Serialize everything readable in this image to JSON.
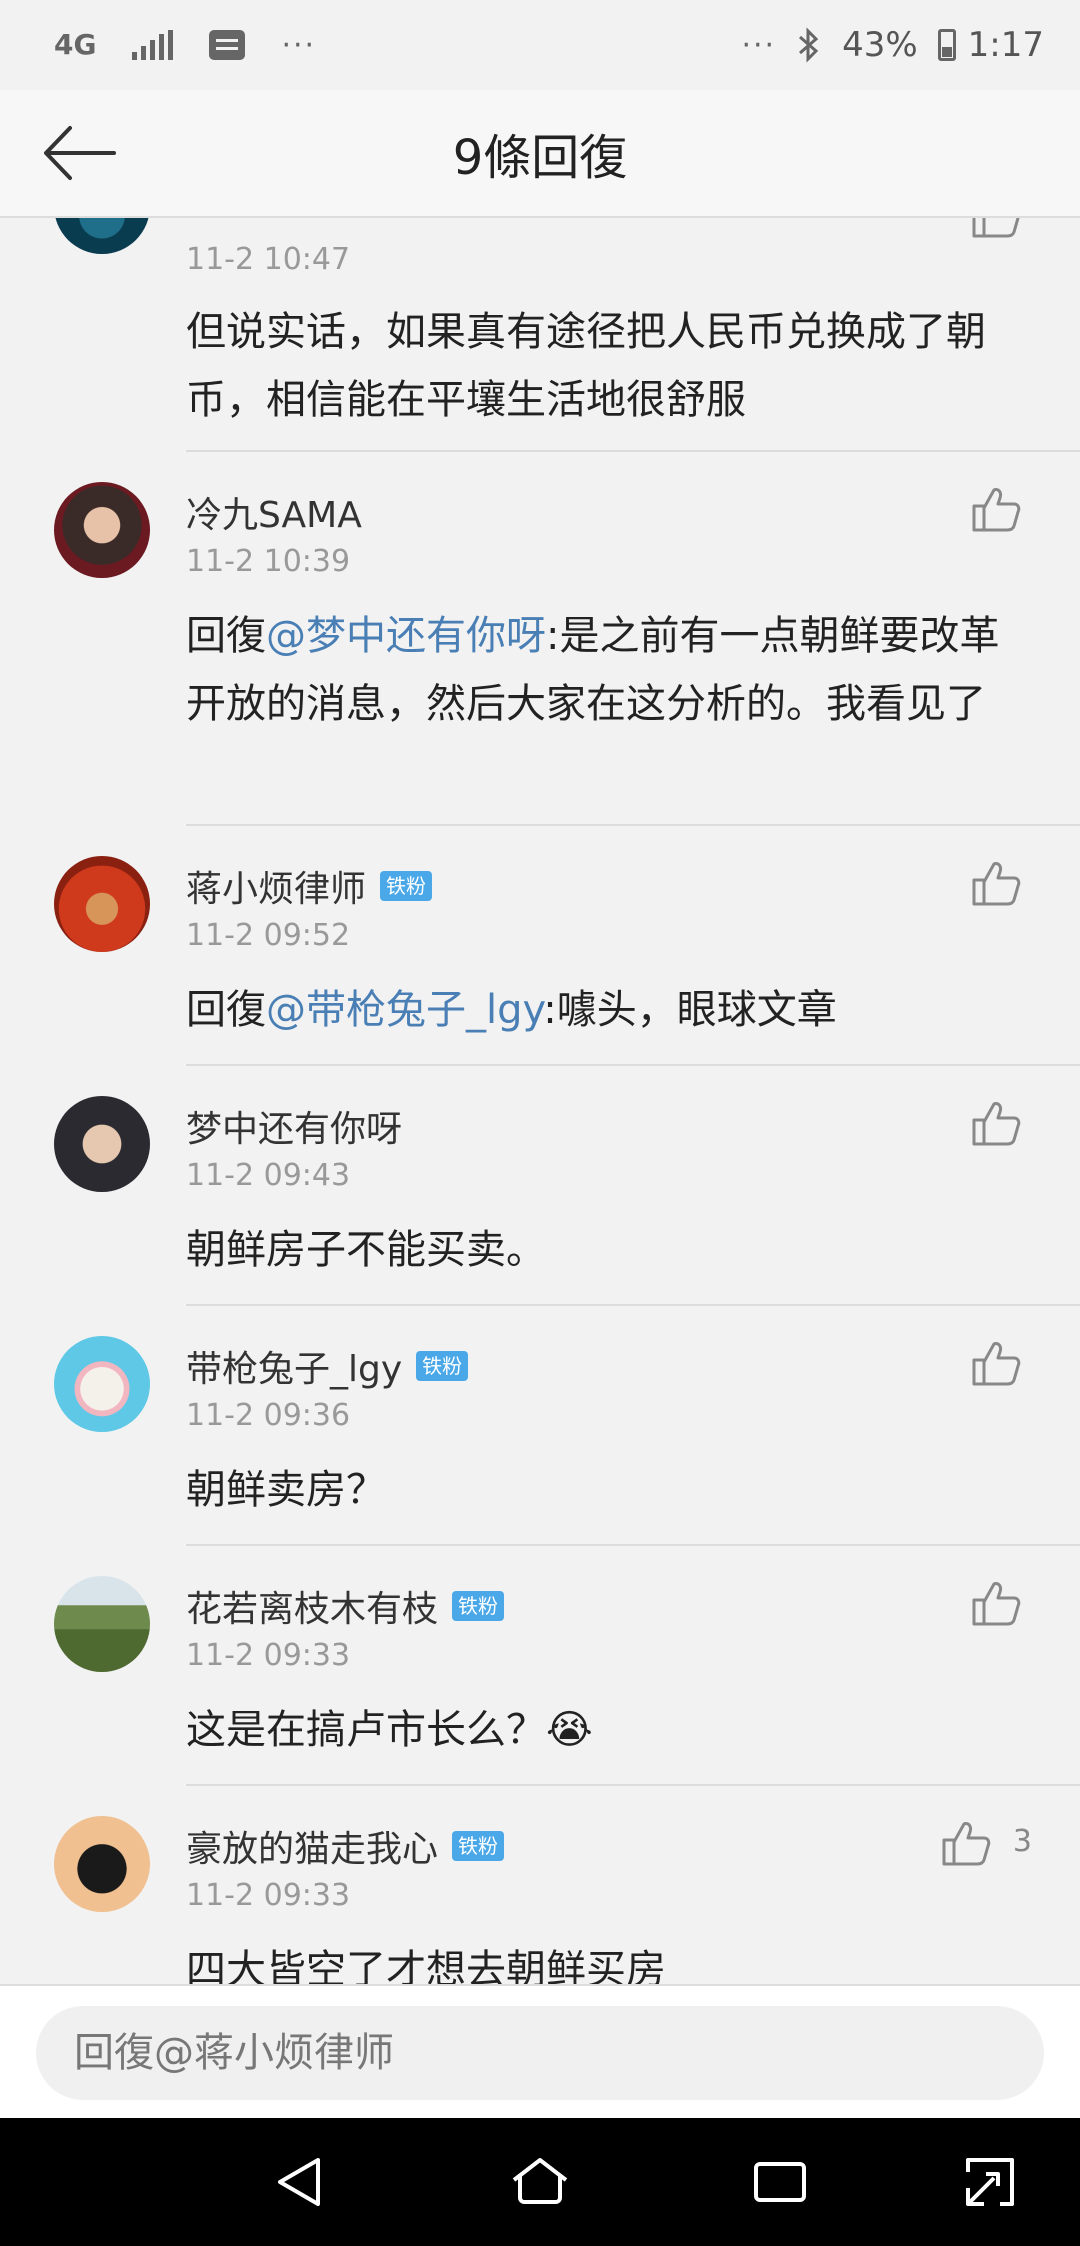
{
  "status": {
    "network": "4G",
    "battery": "43%",
    "time": "1:17",
    "more": "···"
  },
  "nav": {
    "title": "9條回復"
  },
  "comments": [
    {
      "name": "",
      "badge": "",
      "time": "11-2 10:47",
      "text": "但说实话，如果真有途径把人民币兑换成了朝币，相信能在平壤生活地很舒服"
    },
    {
      "name": "冷九SAMA",
      "badge": "",
      "time": "11-2 10:39",
      "prefix": "回復",
      "mention": "@梦中还有你呀",
      "text": ":是之前有一点朝鲜要改革开放的消息，然后大家在这分析的。我看见了"
    },
    {
      "name": "蒋小烦律师",
      "badge": "铁粉",
      "time": "11-2 09:52",
      "prefix": "回復",
      "mention": "@带枪兔子_lgy",
      "text": ":噱头，眼球文章"
    },
    {
      "name": "梦中还有你呀",
      "badge": "",
      "time": "11-2 09:43",
      "text": "朝鲜房子不能买卖。"
    },
    {
      "name": "带枪兔子_lgy",
      "badge": "铁粉",
      "time": "11-2 09:36",
      "text": "朝鲜卖房？"
    },
    {
      "name": "花若离枝木有枝",
      "badge": "铁粉",
      "time": "11-2 09:33",
      "text": "这是在搞卢市长么？😭"
    },
    {
      "name": "豪放的猫走我心",
      "badge": "铁粉",
      "time": "11-2 09:33",
      "text": "四大皆空了才想去朝鲜买房",
      "likes": "3"
    }
  ],
  "input": {
    "placeholder": "回復@蒋小烦律师"
  },
  "colors": {
    "mention": "#4a7fb5",
    "badge": "#4aa8e8",
    "background": "#f2f2f2"
  }
}
